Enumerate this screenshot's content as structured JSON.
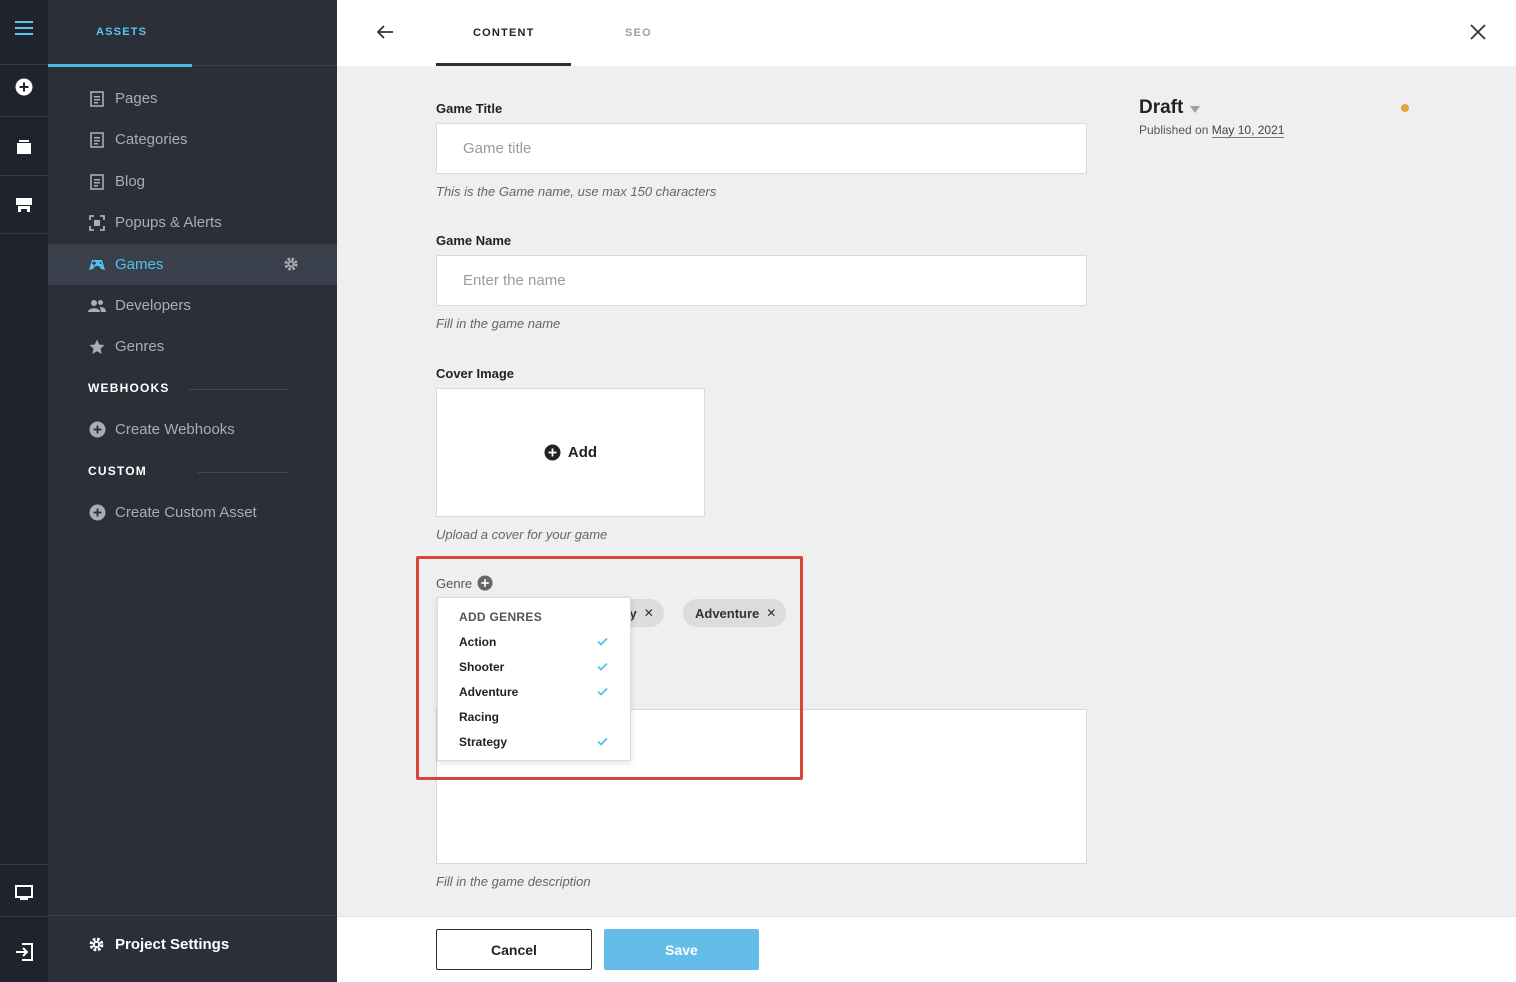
{
  "colors": {
    "accent": "#53c1f0",
    "highlight": "#d9443a",
    "status_dot": "#e0a83a",
    "save": "#63bde8"
  },
  "rail": {
    "icons": [
      "menu-icon",
      "plus-circle-icon",
      "archive-icon",
      "layout-icon",
      "monitor-icon",
      "logout-icon"
    ]
  },
  "sidebar": {
    "header": "ASSETS",
    "items": [
      {
        "label": "Pages",
        "icon": "page-icon"
      },
      {
        "label": "Categories",
        "icon": "page-icon"
      },
      {
        "label": "Blog",
        "icon": "page-icon"
      },
      {
        "label": "Popups & Alerts",
        "icon": "popup-icon"
      },
      {
        "label": "Games",
        "icon": "gamepad-icon",
        "active": true
      },
      {
        "label": "Developers",
        "icon": "users-icon"
      },
      {
        "label": "Genres",
        "icon": "star-icon"
      }
    ],
    "webhooks_section": "WEBHOOKS",
    "create_webhooks": "Create Webhooks",
    "custom_section": "CUSTOM",
    "create_custom": "Create Custom Asset",
    "project_settings": "Project Settings"
  },
  "topbar": {
    "tabs": [
      "CONTENT",
      "SEO"
    ],
    "active_tab": "CONTENT"
  },
  "form": {
    "game_title": {
      "label": "Game Title",
      "placeholder": "Game title",
      "value": "",
      "hint": "This is the Game name, use max 150 characters"
    },
    "game_name": {
      "label": "Game Name",
      "placeholder": "Enter the name",
      "value": "",
      "hint": "Fill in the game name"
    },
    "cover_image": {
      "label": "Cover Image",
      "add_label": "Add",
      "hint": "Upload a cover for your game"
    },
    "genre": {
      "label": "Genre",
      "chips": [
        "tegy",
        "Adventure"
      ],
      "dropdown": {
        "title": "ADD GENRES",
        "options": [
          {
            "label": "Action",
            "checked": true
          },
          {
            "label": "Shooter",
            "checked": true
          },
          {
            "label": "Adventure",
            "checked": true
          },
          {
            "label": "Racing",
            "checked": false
          },
          {
            "label": "Strategy",
            "checked": true
          }
        ]
      }
    },
    "description": {
      "hint": "Fill in the game description"
    }
  },
  "status": {
    "label": "Draft",
    "published_prefix": "Published on",
    "published_date": "May 10, 2021"
  },
  "footer": {
    "cancel": "Cancel",
    "save": "Save"
  }
}
